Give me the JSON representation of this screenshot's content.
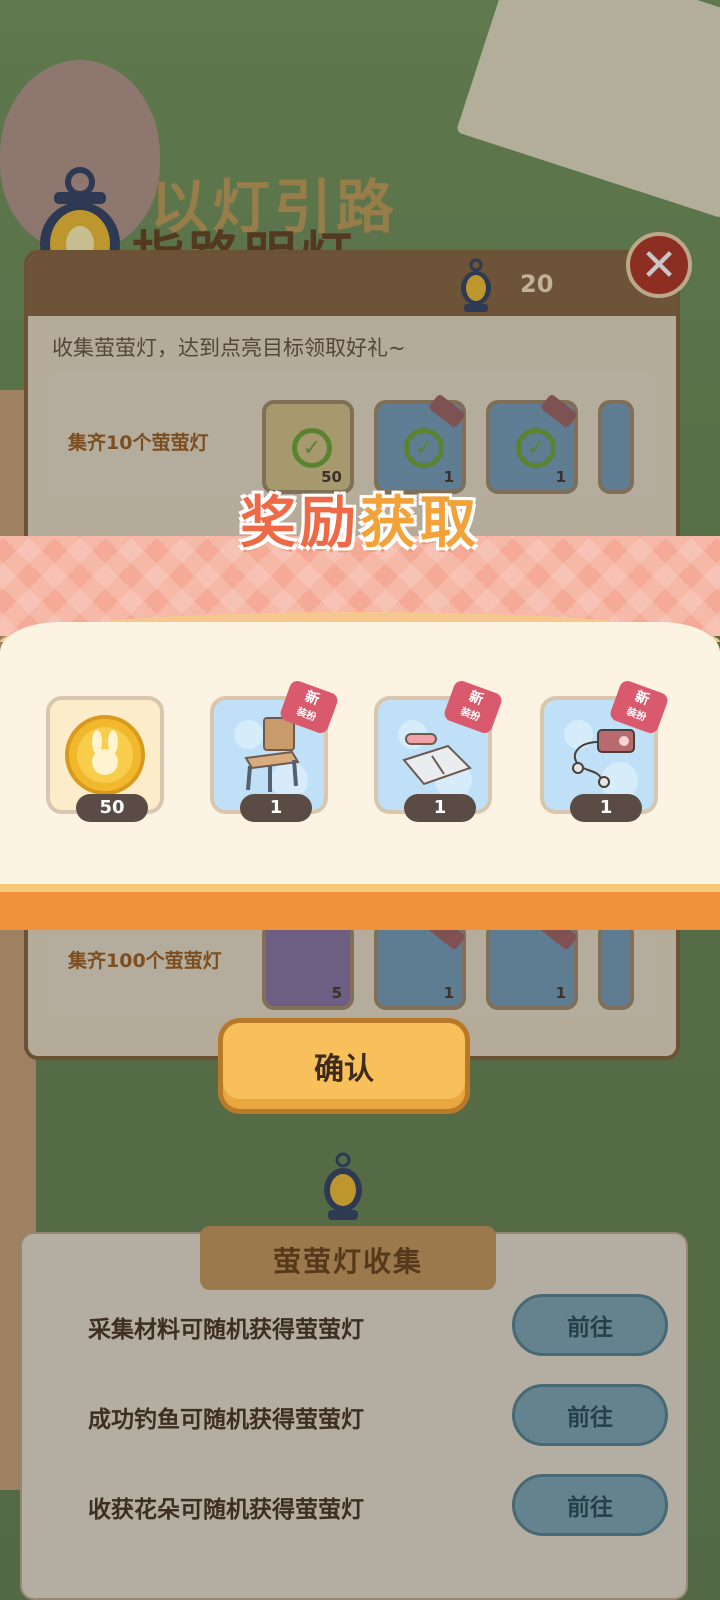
{
  "game": {
    "title_back": "以灯引路",
    "title_front": "指路明灯",
    "lantern_count": "20",
    "close_label": "✕",
    "description": "收集萤萤灯，达到点亮目标领取好礼~"
  },
  "tiers": [
    {
      "label": "集齐10个萤萤灯",
      "items": [
        {
          "count": "50"
        },
        {
          "count": "1"
        },
        {
          "count": "1"
        }
      ]
    },
    {
      "label": "集齐100个萤萤灯",
      "items": [
        {
          "count": "5"
        },
        {
          "count": "1"
        },
        {
          "count": "1"
        }
      ]
    }
  ],
  "reward_popup": {
    "title_part1": "奖励",
    "title_part2": "获取",
    "new_tag": "新",
    "new_tag_sub": "装扮",
    "items": [
      {
        "name": "coin",
        "count": "50"
      },
      {
        "name": "chair",
        "count": "1"
      },
      {
        "name": "desk-mat",
        "count": "1"
      },
      {
        "name": "mp3-player",
        "count": "1"
      }
    ],
    "confirm_label": "确认"
  },
  "collection": {
    "title": "萤萤灯收集",
    "tasks": [
      {
        "text": "采集材料可随机获得萤萤灯",
        "button": "前往"
      },
      {
        "text": "成功钓鱼可随机获得萤萤灯",
        "button": "前往"
      },
      {
        "text": "收获花朵可随机获得萤萤灯",
        "button": "前往"
      }
    ]
  },
  "colors": {
    "accent_orange": "#f0913b",
    "title_red": "#ee6a47",
    "title_gold": "#f3a23a",
    "confirm_yellow": "#f7c05b"
  }
}
